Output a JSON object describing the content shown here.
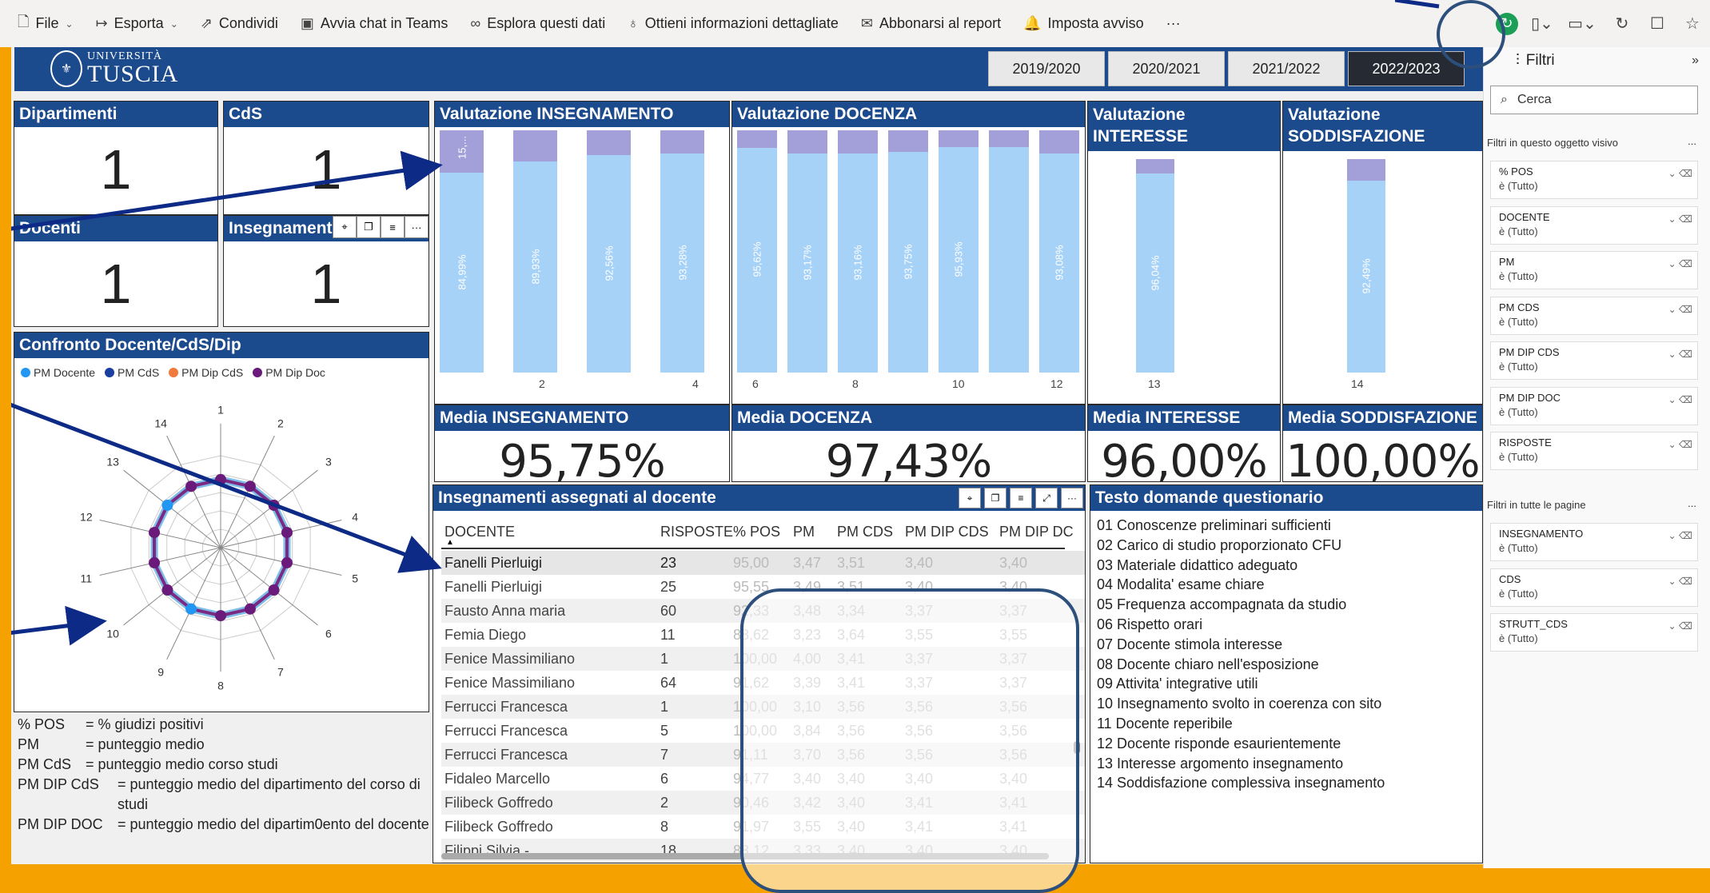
{
  "toolbar": {
    "file": "File",
    "export": "Esporta",
    "share": "Condividi",
    "teams": "Avvia chat in Teams",
    "explore": "Esplora questi dati",
    "insights": "Ottieni informazioni dettagliate",
    "subscribe": "Abbonarsi al report",
    "alert": "Imposta avviso",
    "more": "···"
  },
  "header": {
    "logo_line1": "UNIVERSITÀ",
    "logo_line2": "TUSCIA",
    "years": [
      "2019/2020",
      "2020/2021",
      "2021/2022",
      "2022/2023"
    ],
    "active_year": "2022/2023"
  },
  "kpis": {
    "dipartimenti": {
      "label": "Dipartimenti",
      "value": "1"
    },
    "cds": {
      "label": "CdS",
      "value": "1"
    },
    "docenti": {
      "label": "Docenti",
      "value": "1"
    },
    "insegnamenti": {
      "label": "Insegnamenti",
      "value": "1"
    }
  },
  "radar": {
    "title": "Confronto Docente/CdS/Dip",
    "legend": [
      {
        "name": "PM Docente",
        "color": "#2196f3"
      },
      {
        "name": "PM CdS",
        "color": "#1a3fa0"
      },
      {
        "name": "PM Dip CdS",
        "color": "#f07a3c"
      },
      {
        "name": "PM Dip Doc",
        "color": "#6a1a7a"
      }
    ],
    "axes": [
      "1",
      "2",
      "3",
      "4",
      "5",
      "6",
      "7",
      "8",
      "9",
      "10",
      "11",
      "12",
      "13",
      "14"
    ]
  },
  "definitions": [
    {
      "k": "% POS",
      "v": "= % giudizi positivi"
    },
    {
      "k": "PM",
      "v": "= punteggio medio"
    },
    {
      "k": "PM CdS",
      "v": "= punteggio medio corso studi"
    },
    {
      "k": "PM DIP CdS",
      "v": "= punteggio medio del dipartimento del corso di studi"
    },
    {
      "k": "PM DIP DOC",
      "v": "= punteggio medio del dipartim0ento del docente"
    }
  ],
  "val_insegnamento": {
    "title": "Valutazione INSEGNAMENTO",
    "bars": [
      {
        "q": "1",
        "value": 84.99,
        "label": "84,99%",
        "top_label": "15,..."
      },
      {
        "q": "2",
        "value": 89.93,
        "label": "89,93%"
      },
      {
        "q": "3",
        "value": 92.56,
        "label": "92,56%"
      },
      {
        "q": "4",
        "value": 93.28,
        "label": "93,28%"
      }
    ],
    "xticks": [
      "2",
      "4"
    ]
  },
  "val_docenza": {
    "title": "Valutazione DOCENZA",
    "bars": [
      {
        "q": "5",
        "value": 95.62,
        "label": "95,62%"
      },
      {
        "q": "6",
        "value": 93.17,
        "label": "93,17%"
      },
      {
        "q": "7",
        "value": 93.16,
        "label": "93,16%"
      },
      {
        "q": "8",
        "value": 93.75,
        "label": "93,75%"
      },
      {
        "q": "9",
        "value": 95.93,
        "label": "95,93%"
      },
      {
        "q": "10",
        "value": 96.0,
        "label": ""
      },
      {
        "q": "11",
        "value": 93.08,
        "label": "93,08%"
      }
    ],
    "xticks": [
      "6",
      "8",
      "10",
      "12"
    ]
  },
  "val_interesse": {
    "title": "Valutazione INTERESSE",
    "bars": [
      {
        "q": "13",
        "value": 96.04,
        "label": "96,04%"
      }
    ],
    "xticks": [
      "13"
    ]
  },
  "val_soddisfazione": {
    "title": "Valutazione SODDISFAZIONE",
    "bars": [
      {
        "q": "14",
        "value": 92.49,
        "label": "92,49%"
      }
    ],
    "xticks": [
      "14"
    ]
  },
  "media": {
    "insegnamento": {
      "label": "Media INSEGNAMENTO",
      "value": "95,75%"
    },
    "docenza": {
      "label": "Media DOCENZA",
      "value": "97,43%"
    },
    "interesse": {
      "label": "Media INTERESSE",
      "value": "96,00%"
    },
    "soddisfazione": {
      "label": "Media SODDISFAZIONE",
      "value": "100,00%"
    }
  },
  "table": {
    "title": "Insegnamenti assegnati al docente",
    "columns": [
      "DOCENTE",
      "RISPOSTE",
      "% POS",
      "PM",
      "PM CDS",
      "PM DIP CDS",
      "PM DIP DC"
    ],
    "rows": [
      [
        "Fanelli Pierluigi",
        "23",
        "95,00",
        "3,47",
        "3,51",
        "3,40",
        "3,40"
      ],
      [
        "Fanelli Pierluigi",
        "25",
        "95,55",
        "3,49",
        "3,51",
        "3,40",
        "3,40"
      ],
      [
        "Fausto Anna maria",
        "60",
        "92,33",
        "3,48",
        "3,34",
        "3,37",
        "3,37"
      ],
      [
        "Femia Diego",
        "11",
        "88,62",
        "3,23",
        "3,64",
        "3,55",
        "3,55"
      ],
      [
        "Fenice Massimiliano",
        "1",
        "100,00",
        "4,00",
        "3,41",
        "3,37",
        "3,37"
      ],
      [
        "Fenice Massimiliano",
        "64",
        "91,62",
        "3,39",
        "3,41",
        "3,37",
        "3,37"
      ],
      [
        "Ferrucci Francesca",
        "1",
        "100,00",
        "3,10",
        "3,56",
        "3,56",
        "3,56"
      ],
      [
        "Ferrucci Francesca",
        "5",
        "100,00",
        "3,84",
        "3,56",
        "3,56",
        "3,56"
      ],
      [
        "Ferrucci Francesca",
        "7",
        "91,11",
        "3,70",
        "3,56",
        "3,56",
        "3,56"
      ],
      [
        "Fidaleo Marcello",
        "6",
        "94,77",
        "3,40",
        "3,40",
        "3,40",
        "3,40"
      ],
      [
        "Filibeck Goffredo",
        "2",
        "90,46",
        "3,42",
        "3,40",
        "3,41",
        "3,41"
      ],
      [
        "Filibeck Goffredo",
        "8",
        "91,97",
        "3,55",
        "3,40",
        "3,41",
        "3,41"
      ],
      [
        "Filippi Silvia -",
        "18",
        "88,12",
        "3,33",
        "3,40",
        "3,40",
        "3,40"
      ]
    ]
  },
  "questions": {
    "title": "Testo domande questionario",
    "items": [
      "01 Conoscenze preliminari sufficienti",
      "02 Carico di studio proporzionato CFU",
      "03 Materiale didattico adeguato",
      "04 Modalita' esame chiare",
      "05 Frequenza accompagnata da studio",
      "06 Rispetto orari",
      "07 Docente stimola interesse",
      "08 Docente chiaro nell'esposizione",
      "09 Attivita' integrative utili",
      "10 Insegnamento svolto in coerenza con sito",
      "11 Docente reperibile",
      "12 Docente risponde esaurientemente",
      "13 Interesse argomento insegnamento",
      "14 Soddisfazione complessiva insegnamento"
    ]
  },
  "filters": {
    "title": "Filtri",
    "search_placeholder": "Cerca",
    "section_visual": "Filtri in questo oggetto visivo",
    "section_all": "Filtri in tutte le pagine",
    "visual": [
      {
        "name": "% POS",
        "value": "è (Tutto)"
      },
      {
        "name": "DOCENTE",
        "value": "è (Tutto)"
      },
      {
        "name": "PM",
        "value": "è (Tutto)"
      },
      {
        "name": "PM CDS",
        "value": "è (Tutto)"
      },
      {
        "name": "PM DIP CDS",
        "value": "è (Tutto)"
      },
      {
        "name": "PM DIP DOC",
        "value": "è (Tutto)"
      },
      {
        "name": "RISPOSTE",
        "value": "è (Tutto)"
      }
    ],
    "all": [
      {
        "name": "INSEGNAMENTO",
        "value": "è (Tutto)"
      },
      {
        "name": "CDS",
        "value": "è (Tutto)"
      },
      {
        "name": "STRUTT_CDS",
        "value": "è (Tutto)"
      }
    ]
  },
  "colors": {
    "accent": "#1b4a8d",
    "bar": "#a7d2f8",
    "bar_top": "#a39fd8",
    "frame": "#f5a200"
  }
}
